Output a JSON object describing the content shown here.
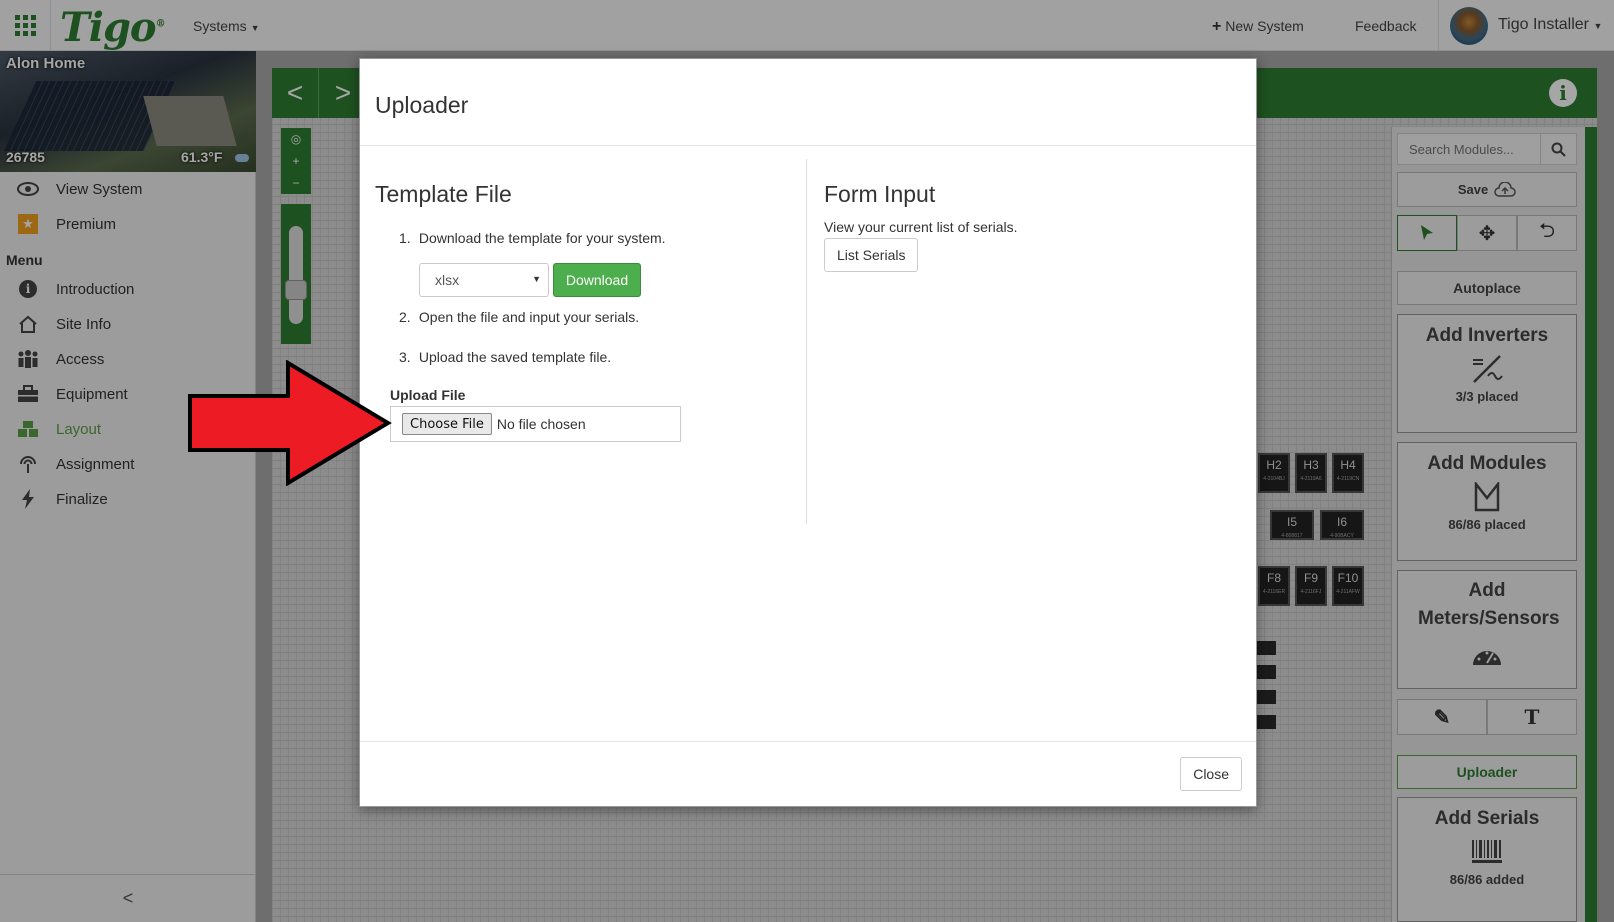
{
  "header": {
    "logo": "Tigo",
    "systems_menu": "Systems",
    "new_system": "New System",
    "feedback": "Feedback",
    "user_name": "Tigo Installer"
  },
  "site": {
    "name": "Alon Home",
    "id": "26785",
    "temperature": "61.3°F"
  },
  "sidebar": {
    "top_items": [
      {
        "label": "View System",
        "icon": "eye-icon"
      },
      {
        "label": "Premium",
        "icon": "star-icon"
      }
    ],
    "menu_heading": "Menu",
    "menu_items": [
      {
        "label": "Introduction",
        "icon": "info-icon"
      },
      {
        "label": "Site Info",
        "icon": "home-icon"
      },
      {
        "label": "Access",
        "icon": "people-icon"
      },
      {
        "label": "Equipment",
        "icon": "briefcase-icon"
      },
      {
        "label": "Layout",
        "icon": "layout-icon",
        "active": true
      },
      {
        "label": "Assignment",
        "icon": "broadcast-icon"
      },
      {
        "label": "Finalize",
        "icon": "bolt-icon"
      }
    ],
    "collapse": "<"
  },
  "canvas": {
    "modules": [
      {
        "label": "H2",
        "serial": "4-2104BJ"
      },
      {
        "label": "H3",
        "serial": "4-2119A6"
      },
      {
        "label": "H4",
        "serial": "4-2119CN"
      },
      {
        "label": "I5",
        "serial": "4-808817"
      },
      {
        "label": "I6",
        "serial": "4-90BACY"
      },
      {
        "label": "F8",
        "serial": "4-2116ER"
      },
      {
        "label": "F9",
        "serial": "4-2116FJ"
      },
      {
        "label": "F10",
        "serial": "4-211AFW"
      }
    ]
  },
  "tools": {
    "search_placeholder": "Search Modules...",
    "save": "Save",
    "autoplace": "Autoplace",
    "inverters": {
      "title": "Add Inverters",
      "status": "3/3 placed"
    },
    "modules": {
      "title": "Add Modules",
      "status": "86/86 placed"
    },
    "meters": {
      "title": "Add Meters/Sensors"
    },
    "uploader": "Uploader",
    "serials": {
      "title": "Add Serials",
      "status": "86/86 added"
    }
  },
  "modal": {
    "title": "Uploader",
    "template": {
      "heading": "Template File",
      "step1": "Download the template for your system.",
      "format_selected": "xlsx",
      "download": "Download",
      "step2": "Open the file and input your serials.",
      "step3": "Upload the saved template file.",
      "upload_label": "Upload File",
      "choose_file": "Choose File",
      "no_file": "No file chosen"
    },
    "form_input": {
      "heading": "Form Input",
      "description": "View your current list of serials.",
      "list_serials": "List Serials"
    },
    "close": "Close"
  },
  "colors": {
    "brand_green": "#2e7d32",
    "download_green": "#4cae4c",
    "arrow_red": "#ed1c24"
  }
}
